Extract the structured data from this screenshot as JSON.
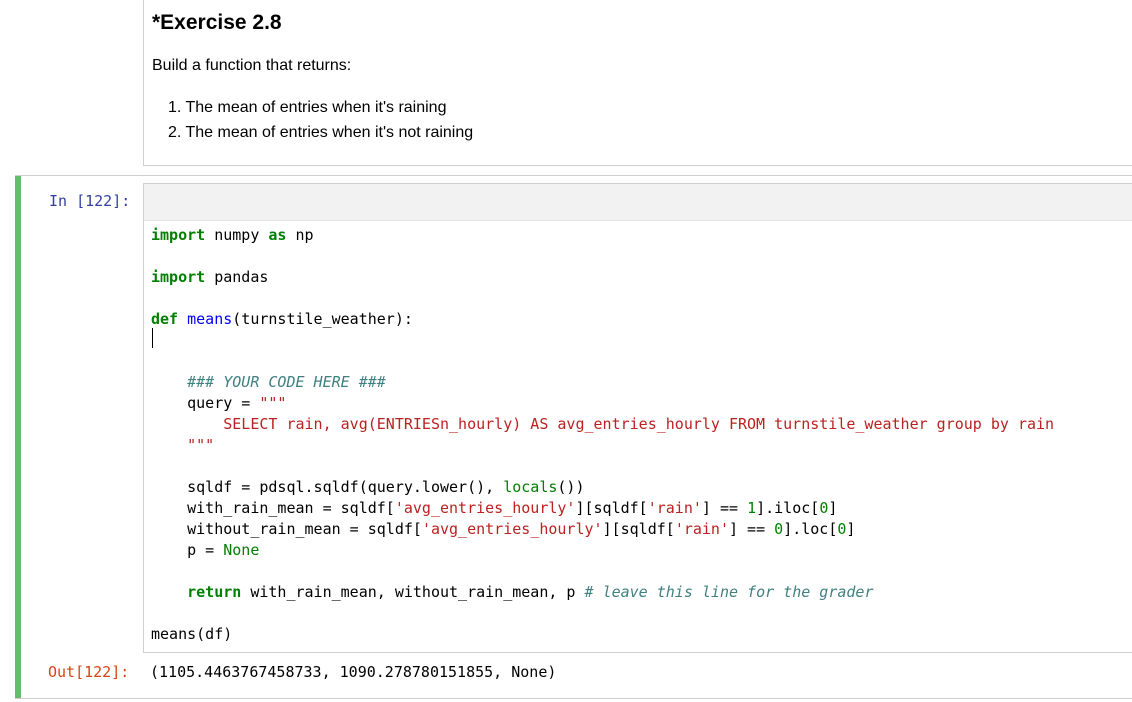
{
  "markdown": {
    "title": "*Exercise 2.8",
    "intro": "Build a function that returns:",
    "items": [
      "1. The mean of entries when it's raining",
      "2. The mean of entries when it's not raining"
    ]
  },
  "cell": {
    "in_prompt": "In [122]:",
    "out_prompt": "Out[122]:",
    "output": "(1105.4463767458733, 1090.278780151855, None)"
  },
  "code": {
    "l1": {
      "kw1": "import",
      "t1": " numpy ",
      "kw2": "as",
      "t2": " np"
    },
    "l2": {
      "kw1": "import",
      "t1": " pandas"
    },
    "l3": {
      "kw1": "def",
      "sp": " ",
      "fn": "means",
      "t1": "(turnstile_weather):"
    },
    "l4": {
      "indent": "    ",
      "com": "### YOUR CODE HERE ###"
    },
    "l5": {
      "t1": "    query = ",
      "str": "\"\"\""
    },
    "l6": {
      "str": "        SELECT rain, avg(ENTRIESn_hourly) AS avg_entries_hourly FROM turnstile_weather group by rain"
    },
    "l7": {
      "str": "    \"\"\""
    },
    "l8": {
      "t1": "    sqldf = pdsql.sqldf(query.lower(), ",
      "cst": "locals",
      "t2": "())"
    },
    "l9": {
      "t1": "    with_rain_mean = sqldf[",
      "s1": "'avg_entries_hourly'",
      "t2": "][sqldf[",
      "s2": "'rain'",
      "t3": "] == ",
      "n1": "1",
      "t4": "].iloc[",
      "n2": "0",
      "t5": "]"
    },
    "l10": {
      "t1": "    without_rain_mean = sqldf[",
      "s1": "'avg_entries_hourly'",
      "t2": "][sqldf[",
      "s2": "'rain'",
      "t3": "] == ",
      "n1": "0",
      "t4": "].loc[",
      "n2": "0",
      "t5": "]"
    },
    "l11": {
      "t1": "    p = ",
      "cst": "None"
    },
    "l12": {
      "indent": "    ",
      "kw": "return",
      "t1": " with_rain_mean, without_rain_mean, p ",
      "com": "# leave this line for the grader"
    },
    "l13": {
      "t1": "means(df)"
    }
  }
}
